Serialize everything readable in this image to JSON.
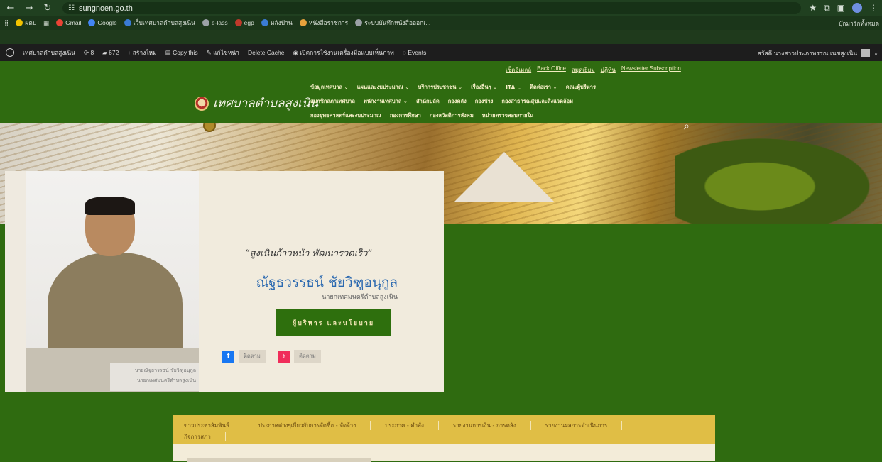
{
  "browser": {
    "url": "sungnoen.go.th",
    "bookmarks": [
      "ผตป",
      "Gmail",
      "Google",
      "เว็บเทศบาลตำบลสูงเนิน",
      "e-lass",
      "egp",
      "หลังบ้าน",
      "หนังสือราชการ",
      "ระบบบันทึกหนังสือออกเ..."
    ],
    "bookmarks_right": "บุ๊กมาร์กทั้งหมด"
  },
  "wpbar": {
    "site": "เทศบาลตำบลสูงเนิน",
    "updates": "8",
    "comments": "672",
    "new": "สร้างใหม่",
    "copy": "Copy this",
    "edit": "แก้ไขหน้า",
    "cache": "Delete Cache",
    "accessibility": "เปิดการใช้งานเครื่องมือแบบเห็นภาพ",
    "events": "Events",
    "greeting": "สวัสดี นางสาวประภาพรรณ เนชสูงเนิน"
  },
  "header": {
    "top_links": [
      "เช็คอีเมลล์",
      "Back Office",
      "สมุดเยี่ยม",
      "ปฏิทิน",
      "Newsletter Subscription"
    ],
    "logo_text": "เทศบาลตำบลสูงเนิน",
    "menu_rows": [
      [
        {
          "label": "ข้อมูลเทศบาล",
          "dd": true
        },
        {
          "label": "แผนและงบประมาณ",
          "dd": true
        },
        {
          "label": "บริการประชาชน",
          "dd": true
        },
        {
          "label": "เรื่องอื่นๆ",
          "dd": true
        },
        {
          "label": "ITA",
          "dd": true
        },
        {
          "label": "ติดต่อเรา",
          "dd": true
        },
        {
          "label": "คณะผู้บริหาร",
          "dd": false
        }
      ],
      [
        {
          "label": "สมาชิกสภาเทศบาล",
          "dd": false
        },
        {
          "label": "พนักงานเทศบาล",
          "dd": true
        },
        {
          "label": "สำนักปลัด",
          "dd": false
        },
        {
          "label": "กองคลัง",
          "dd": false
        },
        {
          "label": "กองช่าง",
          "dd": false
        },
        {
          "label": "กองสาธารณสุขและสิ่งแวดล้อม",
          "dd": false
        }
      ],
      [
        {
          "label": "กองยุทธศาสตร์และงบประมาณ",
          "dd": false
        },
        {
          "label": "กองการศึกษา",
          "dd": false
        },
        {
          "label": "กองสวัสดิการสังคม",
          "dd": false
        },
        {
          "label": "หน่วยตรวจสอบภายใน",
          "dd": false
        }
      ]
    ]
  },
  "mayor": {
    "slogan": "“สูงเนินก้าวหน้า พัฒนารวดเร็ว”",
    "name": "ณัฐธวรรธน์ ชัยวิฑูอนุกูล",
    "title": "นายกเทศมนตรีตำบลสูงเนิน",
    "button": "ผู้บริหาร และนโยบาย",
    "plate_line1": "นายณัฐธวรรธน์ ชัยวิฑูอนุกูล",
    "plate_line2": "นายกเทศมนตรีตำบลสูงเนิน",
    "follow_fb": "ติดตาม",
    "follow_tt": "ติดตาม"
  },
  "tabs": [
    "ข่าวประชาสัมพันธ์",
    "ประกาศต่างๆเกี่ยวกับการจัดซื้อ - จัดจ้าง",
    "ประกาศ - คำสั่ง",
    "รายงานการเงิน - การคลัง",
    "รายงานผลการดำเนินการ",
    "กิจการสภา"
  ],
  "colors": {
    "site_green": "#2f6b10",
    "tab_gold": "#e0be45",
    "button_green": "#2e6f0d",
    "name_blue": "#2b69b0"
  }
}
